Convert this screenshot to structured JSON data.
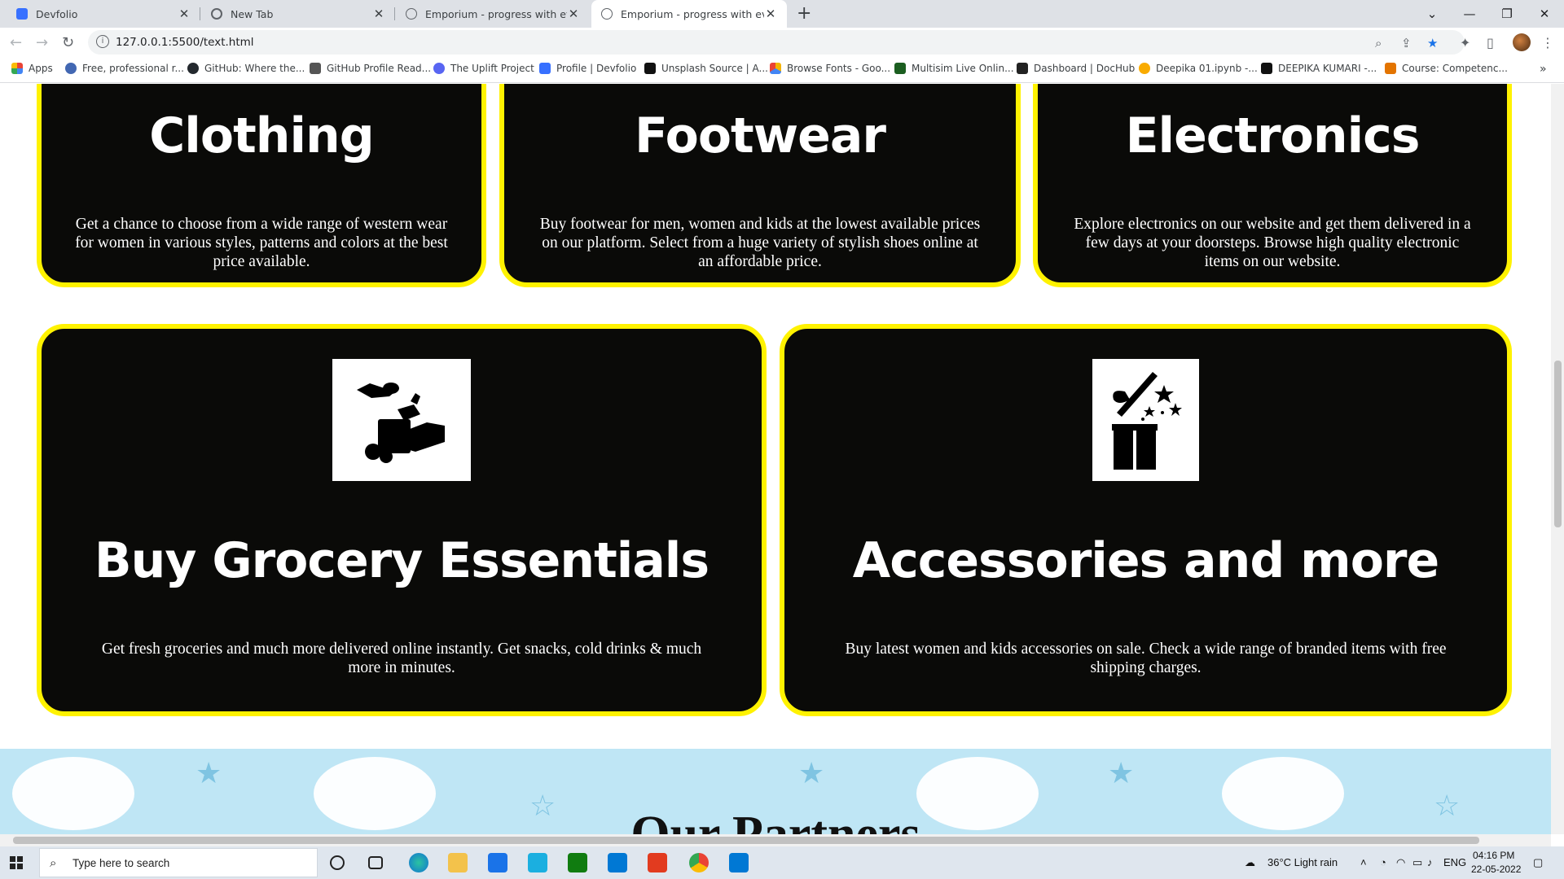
{
  "browser": {
    "tabs": [
      {
        "title": "Devfolio",
        "active": false
      },
      {
        "title": "New Tab",
        "active": false
      },
      {
        "title": "Emporium - progress with every",
        "active": false
      },
      {
        "title": "Emporium - progress with every",
        "active": true
      }
    ],
    "url": "127.0.0.1:5500/text.html",
    "bookmarks": [
      {
        "label": "Apps",
        "color": "#ea4335"
      },
      {
        "label": "Free, professional r...",
        "color": "#4267b2"
      },
      {
        "label": "GitHub: Where the...",
        "color": "#24292e"
      },
      {
        "label": "GitHub Profile Read...",
        "color": "#555555"
      },
      {
        "label": "The Uplift Project",
        "color": "#5865f2"
      },
      {
        "label": "Profile | Devfolio",
        "color": "#3770ff"
      },
      {
        "label": "Unsplash Source | A...",
        "color": "#111111"
      },
      {
        "label": "Browse Fonts - Goo...",
        "color": "#f4b400"
      },
      {
        "label": "Multisim Live Onlin...",
        "color": "#1b5e20"
      },
      {
        "label": "Dashboard | DocHub",
        "color": "#222222"
      },
      {
        "label": "Deepika 01.ipynb -...",
        "color": "#f9ab00"
      },
      {
        "label": "DEEPIKA KUMARI -...",
        "color": "#111111"
      },
      {
        "label": "Course: Competenc...",
        "color": "#e37400"
      }
    ]
  },
  "page": {
    "cards_top": [
      {
        "title": "Clothing",
        "text": "Get a chance to choose from a wide range of western wear for women in various styles, patterns and colors at the best price available."
      },
      {
        "title": "Footwear",
        "text": "Buy footwear for men, women and kids at the lowest available prices on our platform. Select from a huge variety of stylish shoes online at an affordable price."
      },
      {
        "title": "Electronics",
        "text": "Explore electronics on our website and get them delivered in a few days at your doorsteps. Browse high quality electronic items on our website."
      }
    ],
    "cards_big": [
      {
        "title": "Buy Grocery Essentials",
        "text": "Get fresh groceries and much more delivered online instantly. Get snacks, cold drinks & much more in minutes.",
        "icon": "grocery-icon"
      },
      {
        "title": "Accessories and more",
        "text": "Buy latest women and kids accessories on sale. Check a wide range of branded items with free shipping charges.",
        "icon": "gift-box-icon"
      }
    ],
    "partners_heading": "Our Partners",
    "accent_color": "#fff200"
  },
  "taskbar": {
    "search_placeholder": "Type here to search",
    "weather": "36°C  Light rain",
    "lang": "ENG",
    "time": "04:16 PM",
    "date": "22-05-2022"
  }
}
